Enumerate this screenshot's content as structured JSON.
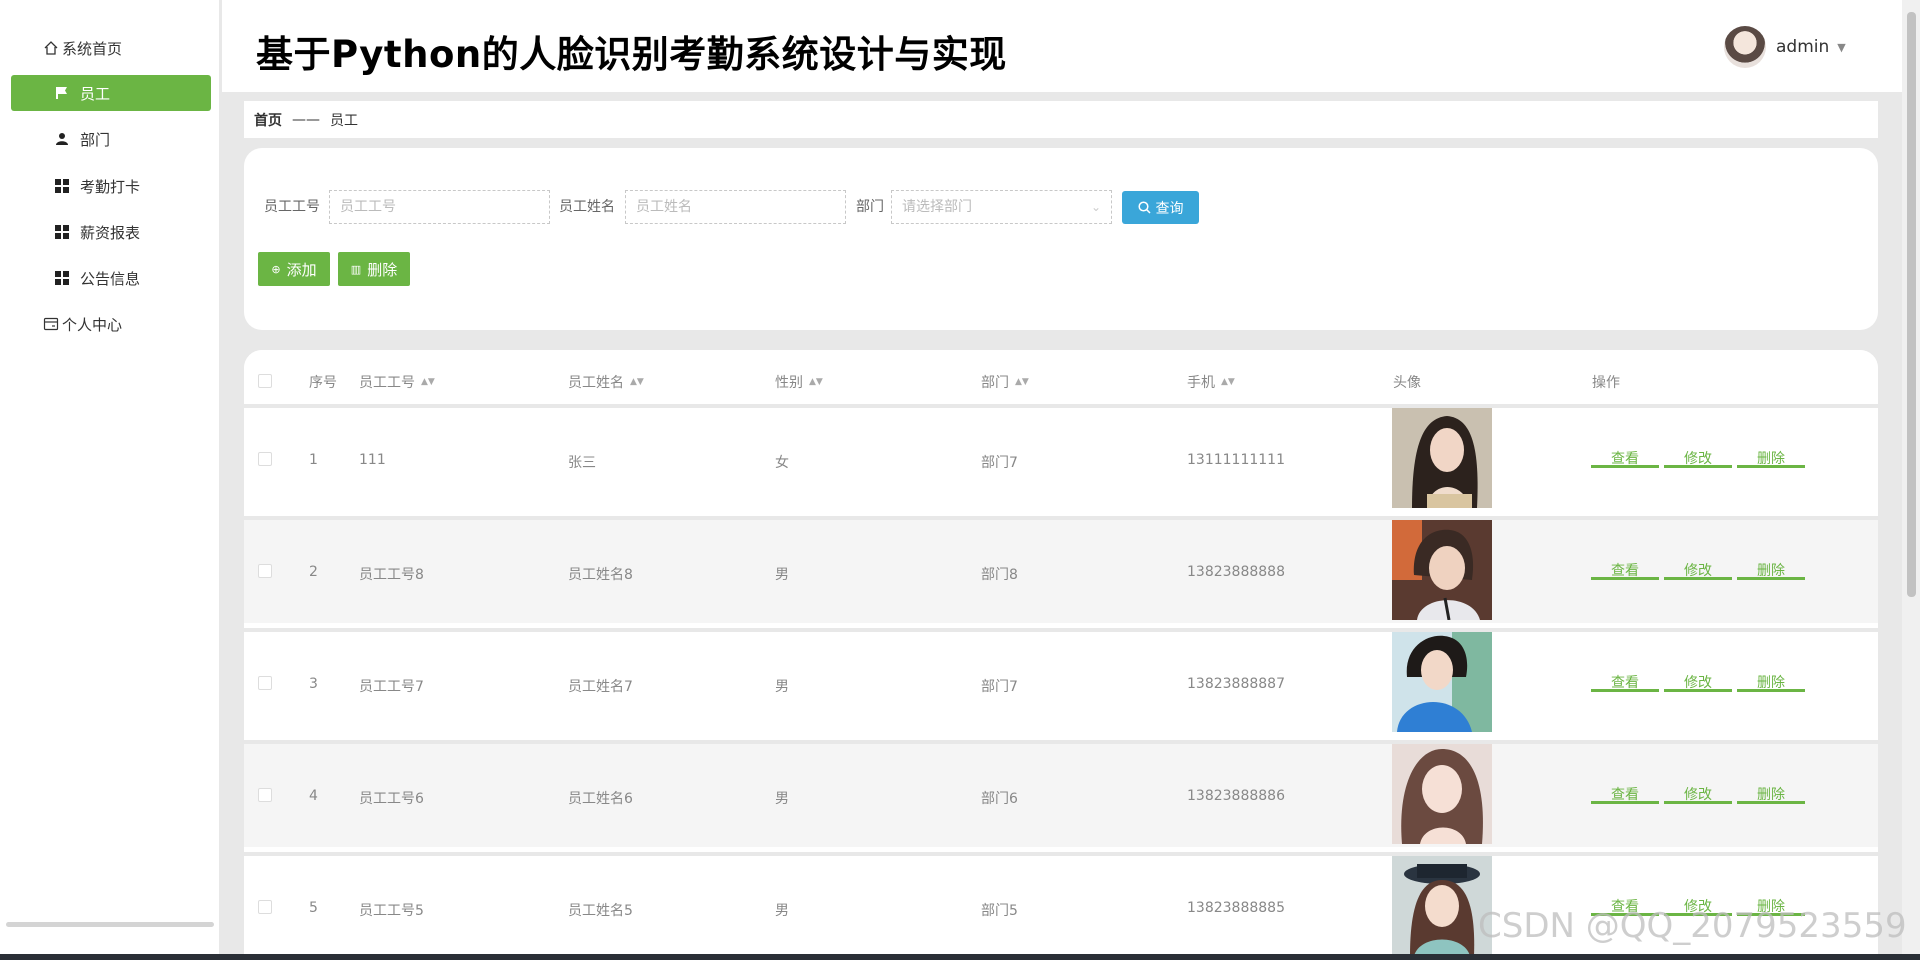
{
  "sidebar": {
    "items": [
      {
        "label": "系统首页",
        "icon": "home-icon"
      },
      {
        "label": "员工",
        "icon": "flag-icon",
        "active": true
      },
      {
        "label": "部门",
        "icon": "person-icon"
      },
      {
        "label": "考勤打卡",
        "icon": "grid-icon"
      },
      {
        "label": "薪资报表",
        "icon": "grid-icon"
      },
      {
        "label": "公告信息",
        "icon": "grid-icon"
      },
      {
        "label": "个人中心",
        "icon": "card-icon"
      }
    ]
  },
  "header": {
    "title": "基于Python的人脸识别考勤系统设计与实现",
    "user": "admin"
  },
  "breadcrumb": {
    "home": "首页",
    "separator": "——",
    "current": "员工"
  },
  "search": {
    "emp_no_label": "员工工号",
    "emp_no_placeholder": "员工工号",
    "emp_name_label": "员工姓名",
    "emp_name_placeholder": "员工姓名",
    "dept_label": "部门",
    "dept_placeholder": "请选择部门",
    "query_label": "查询",
    "add_label": "添加",
    "delete_label": "删除"
  },
  "table": {
    "headers": {
      "index": "序号",
      "emp_no": "员工工号",
      "emp_name": "员工姓名",
      "gender": "性别",
      "dept": "部门",
      "phone": "手机",
      "avatar": "头像",
      "ops": "操作"
    },
    "ops": {
      "view": "查看",
      "edit": "修改",
      "delete": "删除"
    },
    "rows": [
      {
        "index": "1",
        "emp_no": "111",
        "emp_name": "张三",
        "gender": "女",
        "dept": "部门7",
        "phone": "13111111111"
      },
      {
        "index": "2",
        "emp_no": "员工工号8",
        "emp_name": "员工姓名8",
        "gender": "男",
        "dept": "部门8",
        "phone": "13823888888"
      },
      {
        "index": "3",
        "emp_no": "员工工号7",
        "emp_name": "员工姓名7",
        "gender": "男",
        "dept": "部门7",
        "phone": "13823888887"
      },
      {
        "index": "4",
        "emp_no": "员工工号6",
        "emp_name": "员工姓名6",
        "gender": "男",
        "dept": "部门6",
        "phone": "13823888886"
      },
      {
        "index": "5",
        "emp_no": "员工工号5",
        "emp_name": "员工姓名5",
        "gender": "男",
        "dept": "部门5",
        "phone": "13823888885"
      }
    ]
  },
  "watermark": "CSDN @QQ_2079523559",
  "colors": {
    "accent": "#6bb544",
    "query": "#3aa6d9"
  }
}
